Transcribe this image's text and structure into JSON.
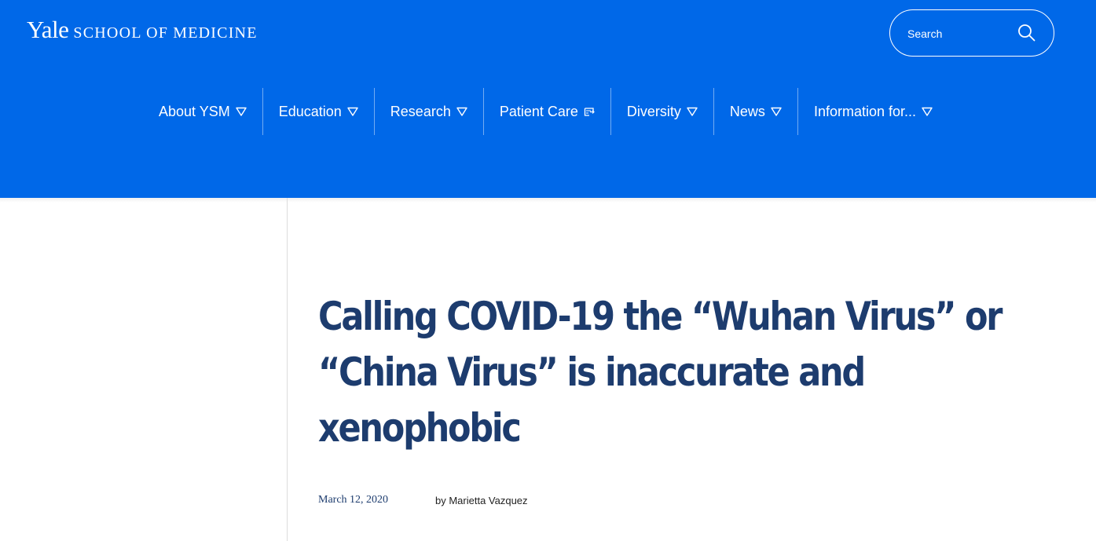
{
  "header": {
    "logo": {
      "yale": "Yale",
      "school": "SCHOOL OF MEDICINE"
    },
    "search": {
      "placeholder": "Search",
      "icon": "search-icon"
    },
    "background_color": "#0068e8",
    "nav": [
      {
        "label": "About YSM",
        "icon": "triangle-down-icon"
      },
      {
        "label": "Education",
        "icon": "triangle-down-icon"
      },
      {
        "label": "Research",
        "icon": "triangle-down-icon"
      },
      {
        "label": "Patient Care",
        "icon": "external-link-icon"
      },
      {
        "label": "Diversity",
        "icon": "triangle-down-icon"
      },
      {
        "label": "News",
        "icon": "triangle-down-icon"
      },
      {
        "label": "Information for...",
        "icon": "triangle-down-icon"
      }
    ]
  },
  "article": {
    "title_lines": [
      "Calling COVID-19 the “Wuhan Virus” or",
      "“China Virus” is inaccurate and",
      "xenophobic"
    ],
    "date": "March 12, 2020",
    "author": "by Marietta Vazquez",
    "title_color": "#1d3c6e"
  }
}
